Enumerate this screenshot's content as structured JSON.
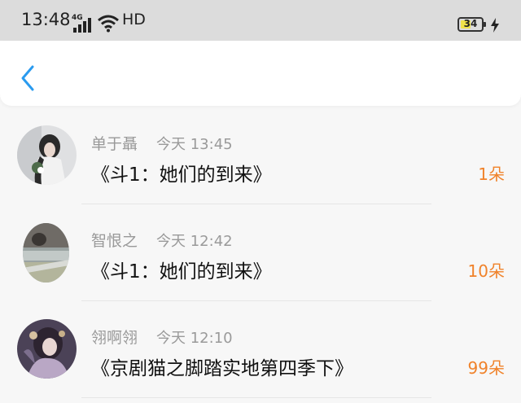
{
  "status_bar": {
    "time": "13:48",
    "network": "4G",
    "hd": "HD",
    "battery": "34",
    "battery_color": "#f0e34a"
  },
  "header": {
    "back_icon": "chevron-left-icon",
    "accent": "#2a9bef"
  },
  "gifts": [
    {
      "user": "单于聶",
      "time": "今天 13:45",
      "title": "《斗1：她们的到来》",
      "count": "1朵"
    },
    {
      "user": "智恨之",
      "time": "今天 12:42",
      "title": "《斗1：她们的到来》",
      "count": "10朵"
    },
    {
      "user": "翎啊翎",
      "time": "今天 12:10",
      "title": "《京剧猫之脚踏实地第四季下》",
      "count": "99朵"
    }
  ],
  "colors": {
    "count": "#f0822a",
    "meta": "#999999"
  }
}
